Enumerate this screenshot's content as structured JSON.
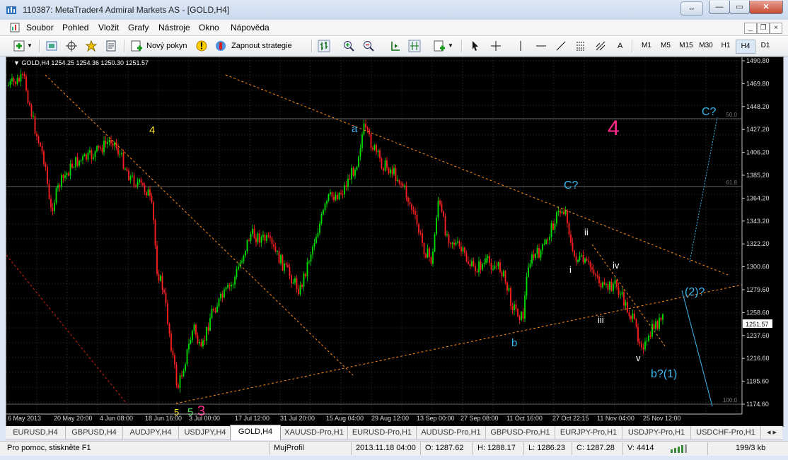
{
  "window": {
    "title": "110387: MetaTrader4 Admiral Markets AS - [GOLD,H4]",
    "close_symbol": "✕",
    "min_symbol": "—",
    "max_symbol": "▭",
    "restore_symbol": "⇔"
  },
  "menu": [
    "Soubor",
    "Pohled",
    "Vložit",
    "Grafy",
    "Nástroje",
    "Okno",
    "Nápověda"
  ],
  "toolbar": {
    "new_order": "Nový pokyn",
    "start_strategy": "Zapnout strategie",
    "text_tool": "A"
  },
  "timeframes": [
    "M1",
    "M5",
    "M15",
    "M30",
    "H1",
    "H4",
    "D1"
  ],
  "active_timeframe": "H4",
  "chart": {
    "symbol_line": "GOLD,H4  1254.25 1254.36 1250.30 1251.57",
    "current_price": "1251.57",
    "price_axis": [
      "1490.80",
      "1469.80",
      "1448.20",
      "1427.20",
      "1406.20",
      "1385.20",
      "1364.20",
      "1343.20",
      "1322.20",
      "1300.60",
      "1279.60",
      "1258.60",
      "1237.60",
      "1216.60",
      "1195.60",
      "1174.60"
    ],
    "time_axis": [
      "6 May 2013",
      "20 May 20:00",
      "4 Jun 08:00",
      "18 Jun 16:00",
      "3 Jul 00:00",
      "17 Jul 12:00",
      "31 Jul 20:00",
      "15 Aug 04:00",
      "29 Aug 12:00",
      "13 Sep 00:00",
      "27 Sep 08:00",
      "11 Oct 16:00",
      "27 Oct 22:15",
      "11 Nov 04:00",
      "25 Nov 12:00"
    ],
    "fib_labels": [
      "50.0",
      "61.8",
      "100.0"
    ],
    "wave_labels": {
      "four_yellow": "4",
      "a": "a",
      "b": "b",
      "c_mid": "C?",
      "four_pink": "4",
      "c_top": "C?",
      "i": "i",
      "ii": "ii",
      "iii": "iii",
      "iv": "iv",
      "v": "v",
      "two_q": "(2)?",
      "b_one": "b?(1)",
      "five_a": "5",
      "five_b": "5",
      "three": "3"
    },
    "colors": {
      "bull": "#00e000",
      "bear": "#ff2020",
      "trend": "#ff8c1a",
      "cyan": "#3bb8f0",
      "pink": "#ff2a8a",
      "yellow": "#ffe12a"
    }
  },
  "tabs": [
    "EURUSD,H4",
    "GBPUSD,H4",
    "AUDJPY,H4",
    "USDJPY,H4",
    "GOLD,H4",
    "XAUUSD-Pro,H1",
    "EURUSD-Pro,H1",
    "AUDUSD-Pro,H1",
    "GBPUSD-Pro,H1",
    "EURJPY-Pro,H1",
    "USDJPY-Pro,H1",
    "USDCHF-Pro,H1"
  ],
  "active_tab": "GOLD,H4",
  "status": {
    "help": "Pro pomoc, stiskněte F1",
    "profile": "MujProfil",
    "datetime": "2013.11.18 04:00",
    "open": "O: 1287.62",
    "high": "H: 1288.17",
    "low": "L: 1286.23",
    "close": "C: 1287.28",
    "volume": "V: 4414",
    "traffic": "199/3 kb"
  }
}
